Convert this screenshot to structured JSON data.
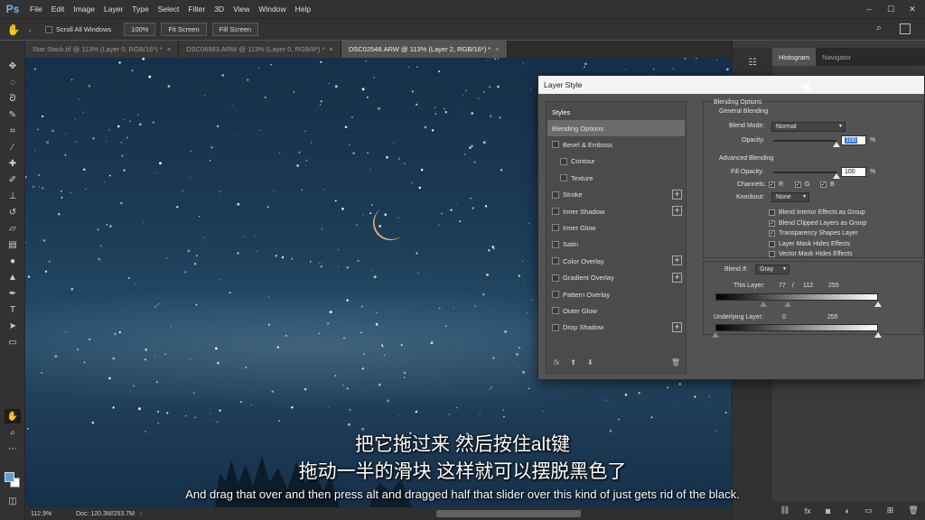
{
  "app": {
    "logo": "Ps"
  },
  "menubar": {
    "items": [
      "File",
      "Edit",
      "Image",
      "Layer",
      "Type",
      "Select",
      "Filter",
      "3D",
      "View",
      "Window",
      "Help"
    ]
  },
  "options": {
    "scroll_all_windows": "Scroll All Windows",
    "zoom_100": "100%",
    "fit_screen": "Fit Screen",
    "fill_screen": "Fill Screen"
  },
  "tabs": [
    {
      "label": "Star Stack.tif @ 113% (Layer 0, RGB/16*) *",
      "close": "×"
    },
    {
      "label": "DSC06583.ARW @ 113% (Layer 0, RGB/8*) *",
      "close": "×"
    },
    {
      "label": "DSC02548.ARW @ 113% (Layer 2, RGB/16*) *",
      "close": "×"
    }
  ],
  "statusbar": {
    "zoom": "112.9%",
    "doc": "Doc: 120.3M/253.7M"
  },
  "right_panel": {
    "tabs": [
      "Histogram",
      "Navigator"
    ]
  },
  "dialog": {
    "title": "Layer Style",
    "styles_header": "Styles",
    "styles": [
      {
        "label": "Blending Options",
        "checkbox": false,
        "selected": true,
        "plus": false
      },
      {
        "label": "Bevel & Emboss",
        "checkbox": true,
        "plus": false
      },
      {
        "label": "Contour",
        "checkbox": true,
        "plus": false,
        "indent": true
      },
      {
        "label": "Texture",
        "checkbox": true,
        "plus": false,
        "indent": true
      },
      {
        "label": "Stroke",
        "checkbox": true,
        "plus": true
      },
      {
        "label": "Inner Shadow",
        "checkbox": true,
        "plus": true
      },
      {
        "label": "Inner Glow",
        "checkbox": true,
        "plus": false
      },
      {
        "label": "Satin",
        "checkbox": true,
        "plus": false
      },
      {
        "label": "Color Overlay",
        "checkbox": true,
        "plus": true
      },
      {
        "label": "Gradient Overlay",
        "checkbox": true,
        "plus": true
      },
      {
        "label": "Pattern Overlay",
        "checkbox": true,
        "plus": false
      },
      {
        "label": "Outer Glow",
        "checkbox": true,
        "plus": false
      },
      {
        "label": "Drop Shadow",
        "checkbox": true,
        "plus": true
      }
    ],
    "fx_label": "fx",
    "blending": {
      "section_title": "Blending Options",
      "general_title": "General Blending",
      "blend_mode_label": "Blend Mode:",
      "blend_mode_value": "Normal",
      "opacity_label": "Opacity:",
      "opacity_value": "100",
      "opacity_level": 1.0,
      "percent": "%",
      "advanced_title": "Advanced Blending",
      "fill_opacity_label": "Fill Opacity:",
      "fill_opacity_value": "100",
      "fill_opacity_level": 1.0,
      "channels_label": "Channels:",
      "channel_r": "R",
      "channel_g": "G",
      "channel_b": "B",
      "knockout_label": "Knockout:",
      "knockout_value": "None",
      "options": [
        {
          "label": "Blend Interior Effects as Group",
          "checked": false
        },
        {
          "label": "Blend Clipped Layers as Group",
          "checked": true
        },
        {
          "label": "Transparency Shapes Layer",
          "checked": true
        },
        {
          "label": "Layer Mask Hides Effects",
          "checked": false
        },
        {
          "label": "Vector Mask Hides Effects",
          "checked": false
        }
      ],
      "blend_if_label": "Blend If:",
      "blend_if_value": "Gray",
      "this_layer_label": "This Layer:",
      "this_layer_values": {
        "low": "77",
        "sep": "/",
        "low2": "112",
        "high": "255"
      },
      "underlying_label": "Underlying Layer:",
      "underlying_values": {
        "low": "0",
        "high": "255"
      }
    }
  },
  "subtitles": {
    "cn1": "把它拖过来 然后按住alt键",
    "cn2": "拖动一半的滑块 这样就可以摆脱黑色了",
    "en": "And drag that over and then press alt and dragged half that slider over this kind of just gets rid of the black."
  },
  "icons": {
    "hand": "hand-tool-icon",
    "search": "search-icon",
    "workspace": "workspace-icon"
  }
}
